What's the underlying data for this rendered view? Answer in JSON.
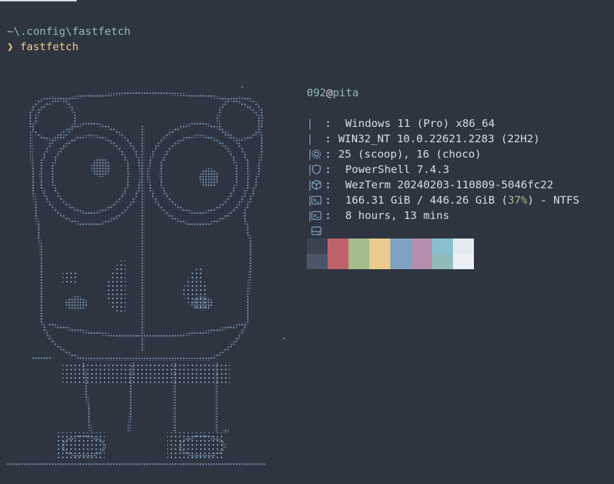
{
  "terminal": {
    "cwd": "~\\.config\\fastfetch",
    "prompt_symbol": "❯",
    "command": "fastfetch"
  },
  "info": {
    "user": "092",
    "at": "@",
    "host": "pita",
    "rows": [
      {
        "icon": "gear-icon",
        "sep": ":",
        "value": "Windows 11 (Pro) x86_64"
      },
      {
        "icon": "shield-icon",
        "sep": ":",
        "value": "WIN32_NT 10.0.22621.2283 (22H2)"
      },
      {
        "icon": "package-icon",
        "sep": ":",
        "value": "25 (scoop), 16 (choco)"
      },
      {
        "icon": "shell-icon",
        "sep": ":",
        "value": "PowerShell 7.4.3"
      },
      {
        "icon": "terminal-icon",
        "sep": ":",
        "value": "WezTerm 20240203-110809-5046fc22"
      },
      {
        "icon": "disk-icon",
        "sep": ":",
        "value_prefix": "166.31 GiB / 446.26 GiB (",
        "value_pct": "37%",
        "value_suffix": ") - NTFS"
      },
      {
        "icon": "clock-icon",
        "sep": ":",
        "value": "8 hours, 13 mins"
      }
    ],
    "bar_char": "|"
  },
  "palette": {
    "top": [
      "#3b4252",
      "#bf616a",
      "#a3be8c",
      "#ebcb8b",
      "#81a1c1",
      "#b48ead",
      "#88c0d0",
      "#e5e9f0"
    ],
    "bottom": [
      "#4c566a",
      "#bf616a",
      "#a3be8c",
      "#ebcb8b",
      "#81a1c1",
      "#b48ead",
      "#8fbcbb",
      "#eceff4"
    ]
  },
  "colors": {
    "background": "#2e3440",
    "foreground": "#d8dee9",
    "accent": "#8fbcbb",
    "ascii": "#81a1c1",
    "prompt": "#ebcb8b",
    "percent": "#a3be8c"
  }
}
